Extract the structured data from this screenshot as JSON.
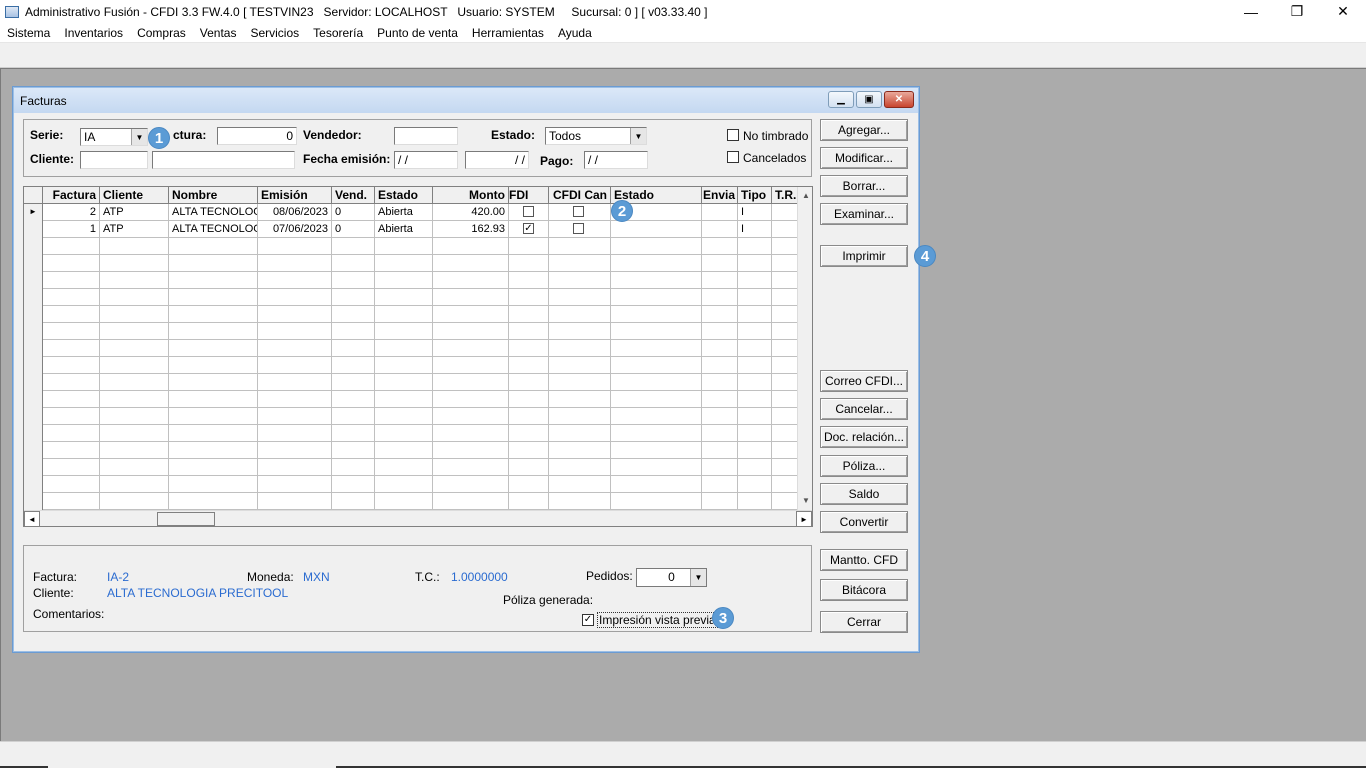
{
  "app": {
    "title": "Administrativo Fusión - CFDI 3.3 FW.4.0 [ TESTVIN23   Servidor: LOCALHOST   Usuario: SYSTEM     Sucursal: 0 ] [ v03.33.40 ]",
    "window_controls": {
      "minimize": "—",
      "restore": "❐",
      "close": "✕"
    }
  },
  "menu": [
    "Sistema",
    "Inventarios",
    "Compras",
    "Ventas",
    "Servicios",
    "Tesorería",
    "Punto de venta",
    "Herramientas",
    "Ayuda"
  ],
  "child_window": {
    "title": "Facturas",
    "controls": {
      "minimize": "▁",
      "maximize": "▣",
      "close": "✕"
    }
  },
  "filters": {
    "serie_label": "Serie:",
    "serie_value": "IA",
    "factura_label": "ctura:",
    "factura_value": "0",
    "vendedor_label": "Vendedor:",
    "vendedor_value": "",
    "estado_label": "Estado:",
    "estado_value": "Todos",
    "cliente_label": "Cliente:",
    "cliente_code": "",
    "cliente_name": "",
    "fecha_label": "Fecha emisión:",
    "fecha_from": "/ /",
    "fecha_to": "/ /",
    "pago_label": "Pago:",
    "pago_value": "/ /",
    "no_timbrado_label": "No timbrado",
    "no_timbrado_checked": false,
    "cancelados_label": "Cancelados",
    "cancelados_checked": false
  },
  "grid": {
    "columns": [
      "Factura",
      "Cliente",
      "Nombre",
      "Emisión",
      "Vend.",
      "Estado",
      "Monto",
      "FDI",
      "CFDI Can",
      "Estado",
      "Envia",
      "Tipo",
      "T.R."
    ],
    "rows": [
      {
        "factura": "2",
        "cliente": "ATP",
        "nombre": "ALTA TECNOLOG",
        "emision": "08/06/2023",
        "vend": "0",
        "estado": "Abierta",
        "monto": "420.00",
        "fdi": false,
        "cfdi_can": false,
        "estado2": "",
        "envia": "",
        "tipo": "I",
        "tr": ""
      },
      {
        "factura": "1",
        "cliente": "ATP",
        "nombre": "ALTA TECNOLOG",
        "emision": "07/06/2023",
        "vend": "0",
        "estado": "Abierta",
        "monto": "162.93",
        "fdi": true,
        "cfdi_can": false,
        "estado2": "",
        "envia": "",
        "tipo": "I",
        "tr": ""
      }
    ],
    "current_row_marker": "►"
  },
  "buttons": {
    "agregar": "Agregar...",
    "modificar": "Modificar...",
    "borrar": "Borrar...",
    "examinar": "Examinar...",
    "imprimir": "Imprimir",
    "correo": "Correo CFDI...",
    "cancelar": "Cancelar...",
    "doc_relacion": "Doc. relación...",
    "poliza": "Póliza...",
    "saldo": "Saldo",
    "convertir": "Convertir",
    "mantto": "Mantto. CFD",
    "bitacora": "Bitácora",
    "cerrar": "Cerrar"
  },
  "info": {
    "factura_label": "Factura:",
    "factura_value": "IA-2",
    "moneda_label": "Moneda:",
    "moneda_value": "MXN",
    "tc_label": "T.C.:",
    "tc_value": "1.0000000",
    "pedidos_label": "Pedidos:",
    "pedidos_value": "0",
    "cliente_label": "Cliente:",
    "cliente_value": "ALTA TECNOLOGIA PRECITOOL",
    "poliza_label": "Póliza generada:",
    "comentarios_label": "Comentarios:",
    "impresion_label": "Impresión vista previa",
    "impresion_checked": true
  },
  "badges": [
    "1",
    "2",
    "3",
    "4"
  ],
  "colors": {
    "mdi_background": "#ababab",
    "info_value": "#2a6bd0",
    "badge": "#5b9bd5"
  }
}
